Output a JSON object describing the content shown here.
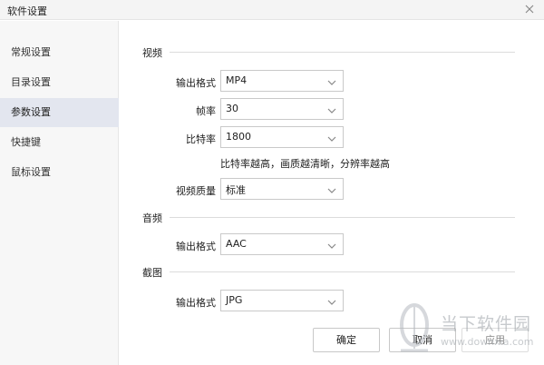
{
  "window": {
    "title": "软件设置"
  },
  "sidebar": {
    "items": [
      {
        "label": "常规设置"
      },
      {
        "label": "目录设置"
      },
      {
        "label": "参数设置",
        "active": true
      },
      {
        "label": "快捷键"
      },
      {
        "label": "鼠标设置"
      }
    ]
  },
  "video": {
    "section_label": "视频",
    "format_label": "输出格式",
    "format_value": "MP4",
    "framerate_label": "帧率",
    "framerate_value": "30",
    "bitrate_label": "比特率",
    "bitrate_value": "1800",
    "hint": "比特率越高，画质越清晰，分辨率越高",
    "quality_label": "视频质量",
    "quality_value": "标准"
  },
  "audio": {
    "section_label": "音频",
    "format_label": "输出格式",
    "format_value": "AAC"
  },
  "screenshot": {
    "section_label": "截图",
    "format_label": "输出格式",
    "format_value": "JPG"
  },
  "footer": {
    "ok_label": "确定",
    "cancel_label": "取消",
    "apply_label": "应用"
  },
  "watermark": {
    "text": "当下软件园",
    "url": "www.downxia.com"
  },
  "colors": {
    "active_item_bg": "#e3e6ef",
    "sidebar_bg": "#f7f7f7",
    "border": "#c9c9c9"
  }
}
